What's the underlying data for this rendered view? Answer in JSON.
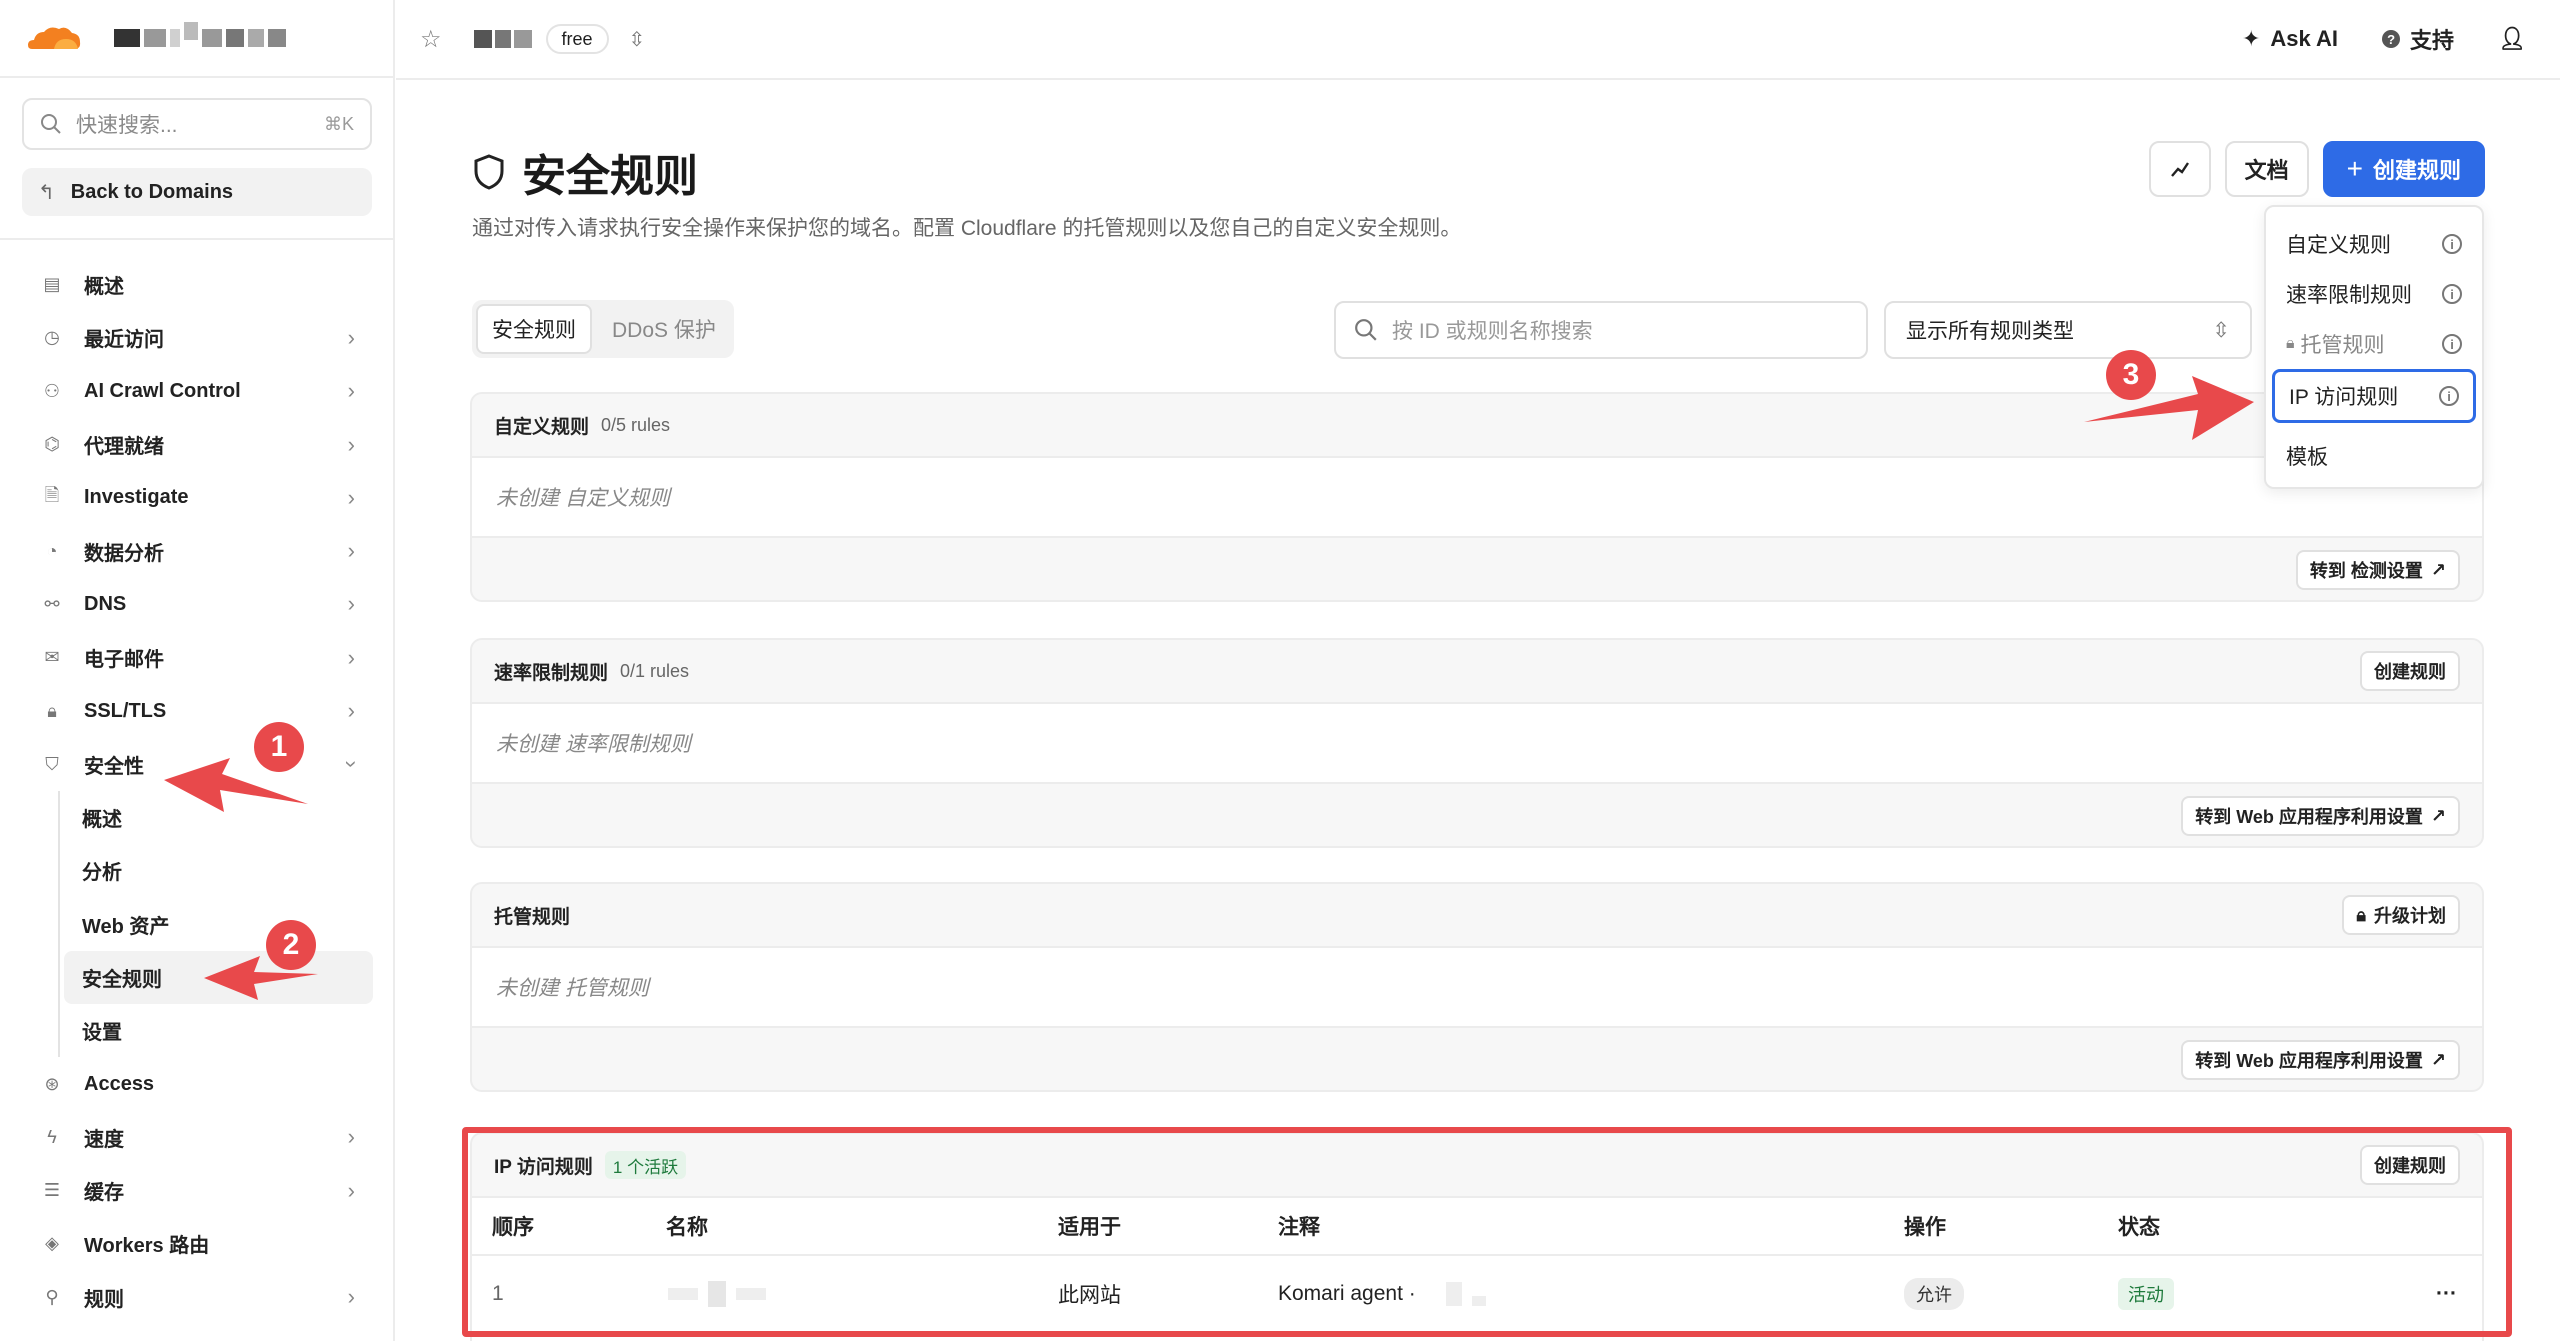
{
  "sidebar": {
    "search": {
      "placeholder": "快速搜索...",
      "shortcut": "⌘K"
    },
    "back_label": "Back to Domains",
    "items": [
      {
        "label": "概述",
        "icon": "document-icon",
        "chevron": false
      },
      {
        "label": "最近访问",
        "icon": "history-icon",
        "chevron": true
      },
      {
        "label": "AI Crawl Control",
        "icon": "robot-icon",
        "chevron": true
      },
      {
        "label": "代理就绪",
        "icon": "proxy-icon",
        "chevron": true
      },
      {
        "label": "Investigate",
        "icon": "investigate-icon",
        "chevron": true
      },
      {
        "label": "数据分析",
        "icon": "analytics-icon",
        "chevron": true
      },
      {
        "label": "DNS",
        "icon": "dns-icon",
        "chevron": true
      },
      {
        "label": "电子邮件",
        "icon": "email-icon",
        "chevron": true
      },
      {
        "label": "SSL/TLS",
        "icon": "lock-icon",
        "chevron": true
      },
      {
        "label": "安全性",
        "icon": "shield-icon",
        "chevron": true
      }
    ],
    "security_sub": [
      "概述",
      "分析",
      "Web 资产",
      "安全规则",
      "设置"
    ],
    "items_after": [
      {
        "label": "Access",
        "icon": "access-icon",
        "chevron": false
      },
      {
        "label": "速度",
        "icon": "bolt-icon",
        "chevron": true
      },
      {
        "label": "缓存",
        "icon": "cache-icon",
        "chevron": true
      },
      {
        "label": "Workers 路由",
        "icon": "workers-icon",
        "chevron": false
      },
      {
        "label": "规则",
        "icon": "rules-icon",
        "chevron": true
      }
    ]
  },
  "topbar": {
    "plan": "free",
    "ask_ai": "Ask AI",
    "support": "支持"
  },
  "page": {
    "title": "安全规则",
    "subtitle": "通过对传入请求执行安全操作来保护您的域名。配置 Cloudflare 的托管规则以及您自己的自定义安全规则。",
    "docs_label": "文档",
    "create_label": "创建规则",
    "tabs": [
      "安全规则",
      "DDoS 保护"
    ],
    "search_placeholder": "按 ID 或规则名称搜索",
    "type_filter": "显示所有规则类型"
  },
  "dropdown": {
    "items": [
      "自定义规则",
      "速率限制规则",
      "托管规则",
      "IP 访问规则",
      "模板"
    ]
  },
  "sections": {
    "custom": {
      "title": "自定义规则",
      "count": "0/5 rules",
      "empty": "未创建 自定义规则",
      "footer_btn": "转到 检测设置"
    },
    "rate": {
      "title": "速率限制规则",
      "count": "0/1 rules",
      "empty": "未创建 速率限制规则",
      "head_btn": "创建规则",
      "footer_btn": "转到 Web 应用程序利用设置"
    },
    "managed": {
      "title": "托管规则",
      "empty": "未创建 托管规则",
      "head_btn": "升级计划",
      "footer_btn": "转到 Web 应用程序利用设置"
    },
    "ip": {
      "title": "IP 访问规则",
      "badge": "1 个活跃",
      "head_btn": "创建规则",
      "columns": [
        "顺序",
        "名称",
        "适用于",
        "注释",
        "操作",
        "状态"
      ],
      "rows": [
        {
          "order": "1",
          "applies_to": "此网站",
          "note": "Komari agent ·",
          "action": "允许",
          "status": "活动"
        }
      ]
    }
  },
  "annotations": [
    "1",
    "2",
    "3"
  ],
  "colors": {
    "primary": "#2e6be6",
    "annotation_red": "#e8494b",
    "cloudflare_orange": "#f38020"
  }
}
